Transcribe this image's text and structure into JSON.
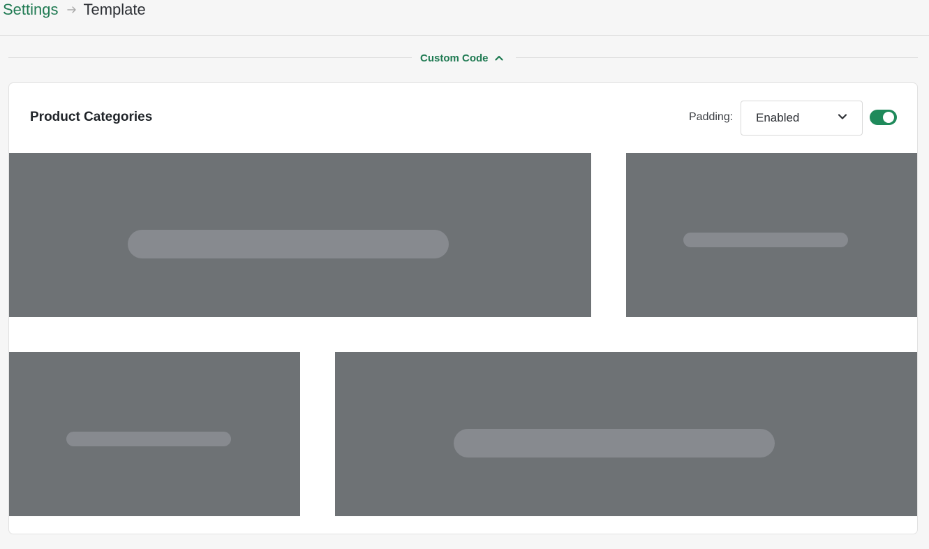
{
  "breadcrumb": {
    "parent": "Settings",
    "current": "Template"
  },
  "section_toggle": {
    "label": "Custom Code",
    "state": "expanded",
    "icon": "chevron-up-icon"
  },
  "card": {
    "title": "Product Categories",
    "padding_label": "Padding:",
    "padding_select_value": "Enabled",
    "toggle_on": true
  },
  "colors": {
    "accent": "#1f7a52",
    "toggle": "#1f8a5b",
    "tile": "#6e7275",
    "pill": "#878a8f"
  },
  "tiles_count_label": ""
}
